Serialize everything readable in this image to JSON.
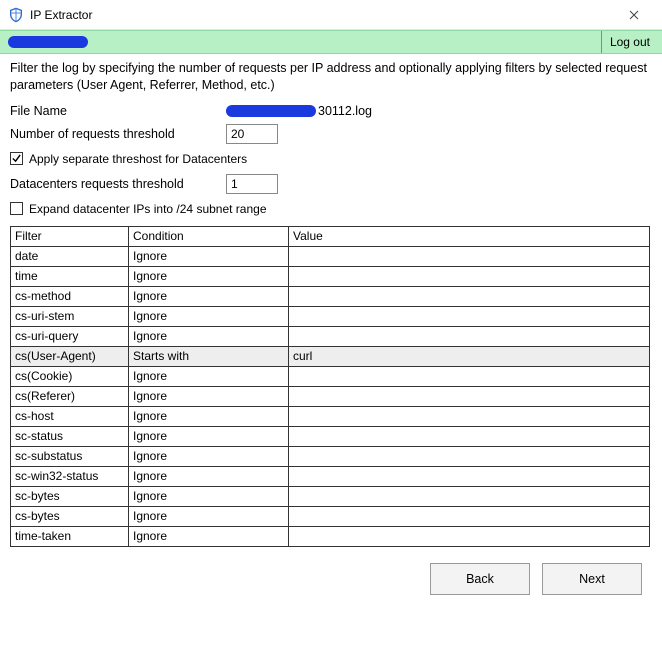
{
  "window": {
    "title": "IP Extractor",
    "close_icon": "close"
  },
  "banner": {
    "logout_label": "Log out"
  },
  "description": "Filter the log by specifying the number of requests per IP address and optionally applying filters by selected request parameters (User Agent, Referrer, Method, etc.)",
  "form": {
    "filename_label": "File Name",
    "filename_suffix": "30112.log",
    "threshold_label": "Number of requests threshold",
    "threshold_value": "20",
    "dc_checkbox_label": "Apply separate threshost for Datacenters",
    "dc_checkbox_checked": true,
    "dc_threshold_label": "Datacenters requests threshold",
    "dc_threshold_value": "1",
    "expand_checkbox_label": "Expand datacenter IPs into /24 subnet range",
    "expand_checkbox_checked": false
  },
  "table": {
    "headers": {
      "filter": "Filter",
      "condition": "Condition",
      "value": "Value"
    },
    "rows": [
      {
        "filter": "date",
        "condition": "Ignore",
        "value": "",
        "selected": false
      },
      {
        "filter": "time",
        "condition": "Ignore",
        "value": "",
        "selected": false
      },
      {
        "filter": "cs-method",
        "condition": "Ignore",
        "value": "",
        "selected": false
      },
      {
        "filter": "cs-uri-stem",
        "condition": "Ignore",
        "value": "",
        "selected": false
      },
      {
        "filter": "cs-uri-query",
        "condition": "Ignore",
        "value": "",
        "selected": false
      },
      {
        "filter": "cs(User-Agent)",
        "condition": "Starts with",
        "value": "curl",
        "selected": true
      },
      {
        "filter": "cs(Cookie)",
        "condition": "Ignore",
        "value": "",
        "selected": false
      },
      {
        "filter": "cs(Referer)",
        "condition": "Ignore",
        "value": "",
        "selected": false
      },
      {
        "filter": "cs-host",
        "condition": "Ignore",
        "value": "",
        "selected": false
      },
      {
        "filter": "sc-status",
        "condition": "Ignore",
        "value": "",
        "selected": false
      },
      {
        "filter": "sc-substatus",
        "condition": "Ignore",
        "value": "",
        "selected": false
      },
      {
        "filter": "sc-win32-status",
        "condition": "Ignore",
        "value": "",
        "selected": false
      },
      {
        "filter": "sc-bytes",
        "condition": "Ignore",
        "value": "",
        "selected": false
      },
      {
        "filter": "cs-bytes",
        "condition": "Ignore",
        "value": "",
        "selected": false
      },
      {
        "filter": "time-taken",
        "condition": "Ignore",
        "value": "",
        "selected": false
      }
    ]
  },
  "footer": {
    "back_label": "Back",
    "next_label": "Next"
  }
}
